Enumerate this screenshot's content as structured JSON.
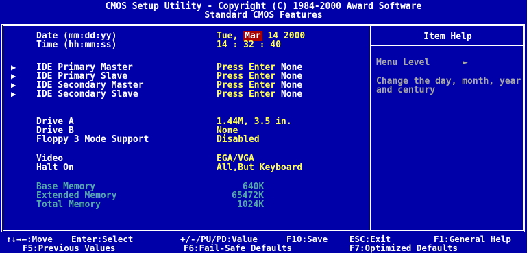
{
  "title": {
    "line1": "CMOS Setup Utility - Copyright (C) 1984-2000 Award Software",
    "line2": "Standard CMOS Features"
  },
  "date": {
    "label": "Date (mm:dd:yy)",
    "day": "Tue,",
    "month": "Mar",
    "rest": "14 2000"
  },
  "time": {
    "label": "Time (hh:mm:ss)",
    "value": "14 : 32 : 40"
  },
  "ide": [
    {
      "label": "IDE Primary Master",
      "action": "Press Enter",
      "status": "None"
    },
    {
      "label": "IDE Primary Slave",
      "action": "Press Enter",
      "status": "None"
    },
    {
      "label": "IDE Secondary Master",
      "action": "Press Enter",
      "status": "None"
    },
    {
      "label": "IDE Secondary Slave",
      "action": "Press Enter",
      "status": "None"
    }
  ],
  "drive_a": {
    "label": "Drive A",
    "value": "1.44M, 3.5 in."
  },
  "drive_b": {
    "label": "Drive B",
    "value": "None"
  },
  "floppy3": {
    "label": "Floppy 3 Mode Support",
    "value": "Disabled"
  },
  "video": {
    "label": "Video",
    "value": "EGA/VGA"
  },
  "halt_on": {
    "label": "Halt On",
    "value": "All,But Keyboard"
  },
  "memory": {
    "base": {
      "label": "Base Memory",
      "value": "640K"
    },
    "extended": {
      "label": "Extended Memory",
      "value": "65472K"
    },
    "total": {
      "label": "Total Memory",
      "value": "1024K"
    }
  },
  "help": {
    "title": "Item Help",
    "menu_level": "Menu Level",
    "arrow": "►",
    "description": "Change the day, month, year and century"
  },
  "footer": {
    "move": "↑↓→←:Move",
    "select": "Enter:Select",
    "value": "+/-/PU/PD:Value",
    "save": "F10:Save",
    "exit": "ESC:Exit",
    "general_help": "F1:General Help",
    "previous": "F5:Previous Values",
    "fail_safe": "F6:Fail-Safe Defaults",
    "optimized": "F7:Optimized Defaults"
  },
  "colors": {
    "background": "#0000a8",
    "value": "#ffff54",
    "label": "#ffffff",
    "disabled": "#54a8a8",
    "highlight": "#a80000"
  }
}
